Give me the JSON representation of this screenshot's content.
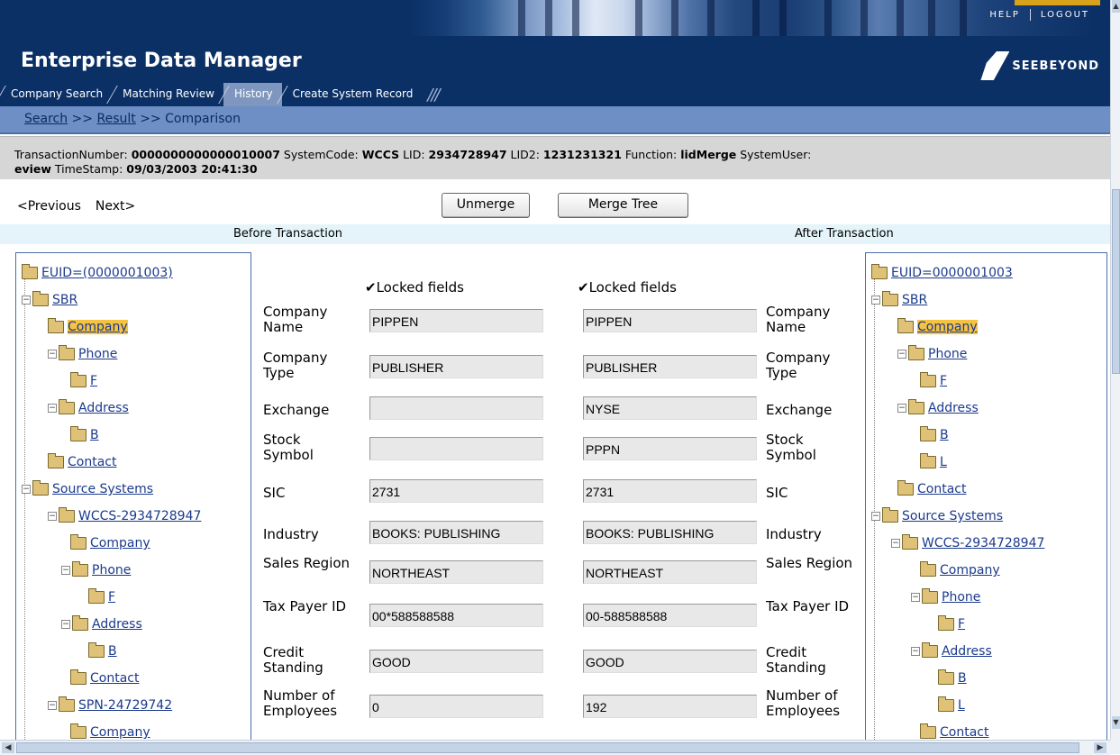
{
  "header": {
    "app_title": "Enterprise Data Manager",
    "help_label": "HELP",
    "logout_label": "LOGOUT",
    "logo_text": "SEEBEYOND"
  },
  "tabs": [
    {
      "label": "Company Search",
      "active": false
    },
    {
      "label": "Matching Review",
      "active": false
    },
    {
      "label": "History",
      "active": true
    },
    {
      "label": "Create System Record",
      "active": false
    }
  ],
  "breadcrumb": {
    "search": "Search",
    "sep1": " >> ",
    "result": "Result",
    "sep2": " >> ",
    "current": "Comparison"
  },
  "transaction": {
    "tn_label": "TransactionNumber: ",
    "tn_value": "0000000000000010007",
    "sc_label": " SystemCode: ",
    "sc_value": "WCCS",
    "lid_label": " LID: ",
    "lid_value": "2934728947",
    "lid2_label": " LID2: ",
    "lid2_value": "1231231321",
    "fn_label": " Function: ",
    "fn_value": "lidMerge",
    "su_label": " SystemUser:",
    "su_value": "eview",
    "ts_label": " TimeStamp: ",
    "ts_value": "09/03/2003 20:41:30"
  },
  "actions": {
    "previous": "<Previous",
    "next": "Next>",
    "unmerge": "Unmerge",
    "merge_tree": "Merge Tree"
  },
  "columns": {
    "before": "Before Transaction",
    "after": "After Transaction"
  },
  "locked_label": "✔Locked fields",
  "fields": [
    {
      "label": "Company Name",
      "before": "PIPPEN",
      "after": "PIPPEN"
    },
    {
      "label": "Company Type",
      "before": "PUBLISHER",
      "after": "PUBLISHER"
    },
    {
      "label": "Exchange",
      "before": "",
      "after": "NYSE"
    },
    {
      "label": "Stock Symbol",
      "before": "",
      "after": "PPPN"
    },
    {
      "label": "SIC",
      "before": "2731",
      "after": "2731"
    },
    {
      "label": "Industry",
      "before": "BOOKS: PUBLISHING",
      "after": "BOOKS: PUBLISHING"
    },
    {
      "label": "Sales Region",
      "before": "NORTHEAST",
      "after": "NORTHEAST"
    },
    {
      "label": "Tax Payer ID",
      "before": "00*588588588",
      "after": "00-588588588"
    },
    {
      "label": "Credit Standing",
      "before": "GOOD",
      "after": "GOOD"
    },
    {
      "label": "Number of Employees",
      "before": "0",
      "after": "192"
    }
  ],
  "tree_before": [
    {
      "label": "EUID=(0000001003)",
      "expander": "",
      "highlight": false
    },
    {
      "label": "SBR",
      "expander": "−",
      "highlight": false
    },
    {
      "label": "Company",
      "expander": "",
      "highlight": true
    },
    {
      "label": "Phone",
      "expander": "−",
      "highlight": false
    },
    {
      "label": "F",
      "expander": "",
      "highlight": false
    },
    {
      "label": "Address",
      "expander": "−",
      "highlight": false
    },
    {
      "label": "B",
      "expander": "",
      "highlight": false
    },
    {
      "label": "Contact",
      "expander": "",
      "highlight": false
    },
    {
      "label": "Source Systems",
      "expander": "−",
      "highlight": false
    },
    {
      "label": "WCCS-2934728947",
      "expander": "−",
      "highlight": false
    },
    {
      "label": "Company",
      "expander": "",
      "highlight": false
    },
    {
      "label": "Phone",
      "expander": "−",
      "highlight": false
    },
    {
      "label": "F",
      "expander": "",
      "highlight": false
    },
    {
      "label": "Address",
      "expander": "−",
      "highlight": false
    },
    {
      "label": "B",
      "expander": "",
      "highlight": false
    },
    {
      "label": "Contact",
      "expander": "",
      "highlight": false
    },
    {
      "label": "SPN-24729742",
      "expander": "−",
      "highlight": false
    },
    {
      "label": "Company",
      "expander": "",
      "highlight": false
    }
  ],
  "tree_after": [
    {
      "label": "EUID=0000001003",
      "expander": "",
      "highlight": false
    },
    {
      "label": "SBR",
      "expander": "−",
      "highlight": false
    },
    {
      "label": "Company",
      "expander": "",
      "highlight": true
    },
    {
      "label": "Phone",
      "expander": "−",
      "highlight": false
    },
    {
      "label": "F",
      "expander": "",
      "highlight": false
    },
    {
      "label": "Address",
      "expander": "−",
      "highlight": false
    },
    {
      "label": "B",
      "expander": "",
      "highlight": false
    },
    {
      "label": "L",
      "expander": "",
      "highlight": false
    },
    {
      "label": "Contact",
      "expander": "",
      "highlight": false
    },
    {
      "label": "Source Systems",
      "expander": "−",
      "highlight": false
    },
    {
      "label": "WCCS-2934728947",
      "expander": "−",
      "highlight": false
    },
    {
      "label": "Company",
      "expander": "",
      "highlight": false
    },
    {
      "label": "Phone",
      "expander": "−",
      "highlight": false
    },
    {
      "label": "F",
      "expander": "",
      "highlight": false
    },
    {
      "label": "Address",
      "expander": "−",
      "highlight": false
    },
    {
      "label": "B",
      "expander": "",
      "highlight": false
    },
    {
      "label": "L",
      "expander": "",
      "highlight": false
    },
    {
      "label": "Contact",
      "expander": "",
      "highlight": false
    }
  ]
}
